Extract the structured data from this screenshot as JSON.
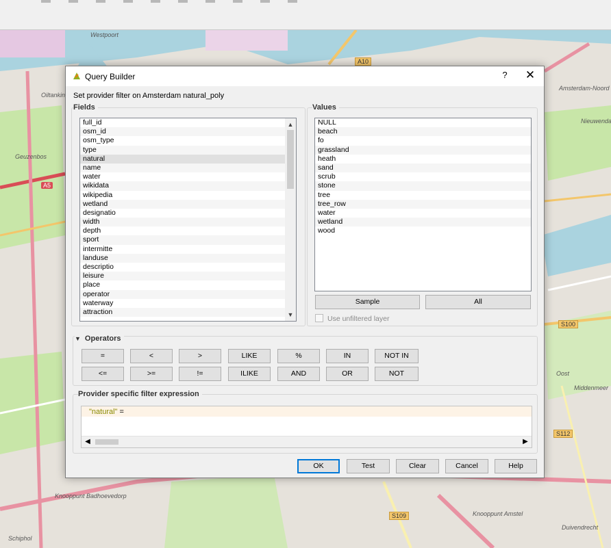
{
  "dialog": {
    "title": "Query Builder",
    "help_label": "?",
    "close_label": "✕",
    "subtitle": "Set provider filter on Amsterdam natural_poly"
  },
  "fields": {
    "label": "Fields",
    "items": [
      "full_id",
      "osm_id",
      "osm_type",
      "type",
      "natural",
      "name",
      "water",
      "wikidata",
      "wikipedia",
      "wetland",
      "designatio",
      "width",
      "depth",
      "sport",
      "intermitte",
      "landuse",
      "descriptio",
      "leisure",
      "place",
      "operator",
      "waterway",
      "attraction"
    ],
    "selected": "natural"
  },
  "values": {
    "label": "Values",
    "items": [
      "NULL",
      "beach",
      "fo",
      "grassland",
      "heath",
      "sand",
      "scrub",
      "stone",
      "tree",
      "tree_row",
      "water",
      "wetland",
      "wood"
    ],
    "sample_label": "Sample",
    "all_label": "All",
    "use_unfiltered_label": "Use unfiltered layer"
  },
  "operators": {
    "label": "Operators",
    "row1": [
      "=",
      "<",
      ">",
      "LIKE",
      "%",
      "IN",
      "NOT IN"
    ],
    "row2": [
      "<=",
      ">=",
      "!=",
      "ILIKE",
      "AND",
      "OR",
      "NOT"
    ]
  },
  "expression": {
    "label": "Provider specific filter expression",
    "field": "\"natural\"",
    "operator": " ="
  },
  "buttons": {
    "ok": "OK",
    "test": "Test",
    "clear": "Clear",
    "cancel": "Cancel",
    "help": "Help"
  },
  "map_labels": {
    "westpoort": "Westpoort",
    "a10": "A10",
    "a5": "A5",
    "s100": "S100",
    "s112": "S112",
    "s109": "S109",
    "oost": "Oost",
    "amsterdam_noord": "Amsterdam-Noord",
    "nieuwendam": "Nieuwendam",
    "middenmeer": "Middenmeer",
    "duivendrecht": "Duivendrecht",
    "schiphol": "Schiphol",
    "knooppunt_badhoevedorp": "Knooppunt Badhoevedorp",
    "knooppunt_amstel": "Knooppunt Amstel",
    "geuzenbos": "Geuzenbos",
    "oiltanking": "Oiltanking"
  },
  "colors": {
    "accent": "#0078d7",
    "road": "#f3c66b",
    "motorway": "#d94d56",
    "water": "#aad3df",
    "park": "#c8e6a8"
  }
}
